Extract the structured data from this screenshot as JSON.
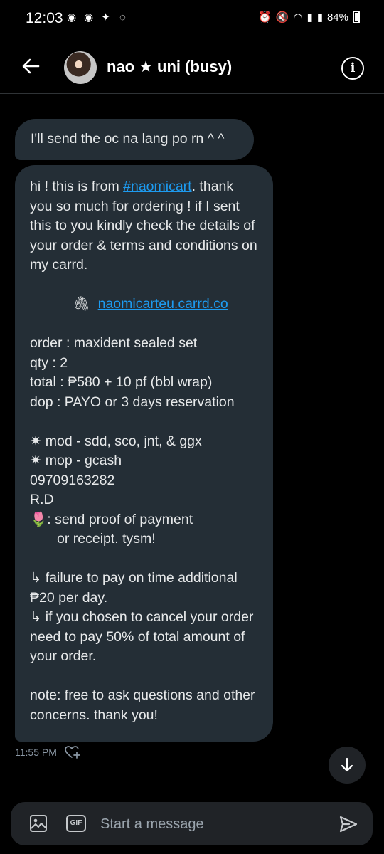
{
  "status_bar": {
    "time": "12:03",
    "battery": "84%"
  },
  "header": {
    "title": "nao ★ uni (busy)"
  },
  "messages": {
    "first": "I'll send the oc na lang po rn ^ ^",
    "second": {
      "intro_1": "hi ! this is from ",
      "hashtag": "#naomicart",
      "intro_2": ". thank you so much for ordering ! if I sent this to you kindly check the details of your order & terms and conditions on my carrd.",
      "carrd_icon": "🖇",
      "carrd_link": "naomicarteu.carrd.co",
      "order": "order : maxident sealed set",
      "qty": "qty : 2",
      "total": "total : ₱580 + 10 pf (bbl wrap)",
      "dop": "dop : PAYO or 3 days reservation",
      "mod": "✷ mod - sdd, sco, jnt, & ggx",
      "mop": "✷ mop - gcash",
      "number": "09709163282",
      "initials": "R.D",
      "proof_1": ": send proof of payment",
      "proof_2": "or receipt. tysm!",
      "proof_emoji": "🌷",
      "failure": "↳ failure to pay on time additional ₱20 per day.",
      "cancel": "↳ if you chosen to cancel your order need to pay 50% of total amount of your order.",
      "note": "note: free to ask questions and other concerns. thank you!"
    },
    "timestamp": "11:55 PM"
  },
  "composer": {
    "gif_label": "GIF",
    "placeholder": "Start a message"
  },
  "icons": {
    "back": "back-arrow-icon",
    "info": "info-icon",
    "image": "image-icon",
    "send": "send-icon",
    "scroll": "arrow-down-icon",
    "react": "heart-plus-icon"
  }
}
